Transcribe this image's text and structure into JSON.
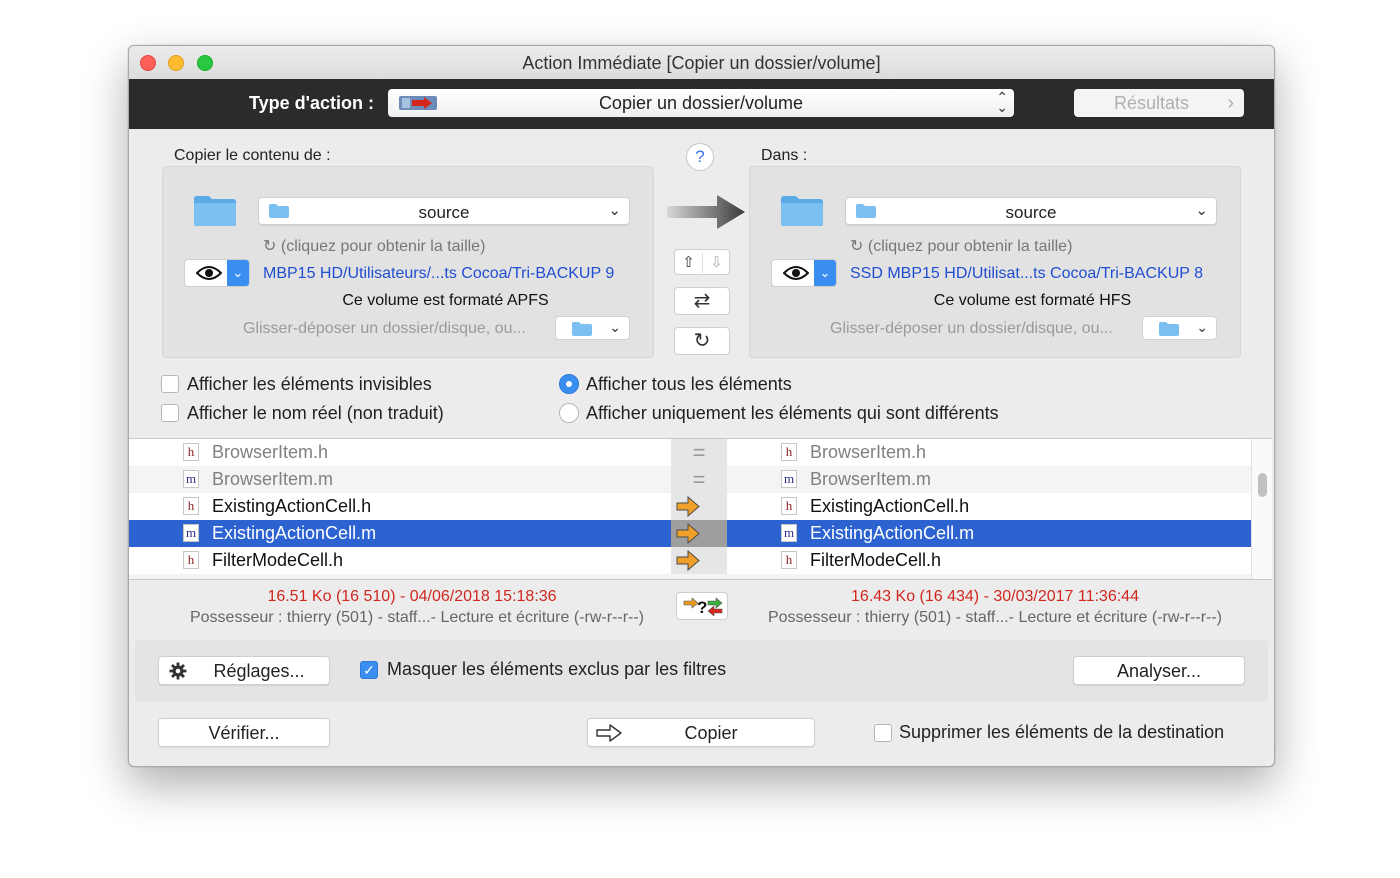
{
  "window": {
    "title": "Action Immédiate [Copier un dossier/volume]"
  },
  "header": {
    "type_label": "Type d'action :",
    "action_value": "Copier un dossier/volume",
    "results_label": "Résultats"
  },
  "source": {
    "heading": "Copier le contenu de :",
    "folder_name": "source",
    "size_hint": "(cliquez pour obtenir la taille)",
    "path": "MBP15 HD/Utilisateurs/...ts Cocoa/Tri-BACKUP 9",
    "format": "Ce volume est formaté APFS",
    "drop_hint": "Glisser-déposer un dossier/disque, ou..."
  },
  "destination": {
    "heading": "Dans :",
    "folder_name": "source",
    "size_hint": "(cliquez pour obtenir la taille)",
    "path": "SSD MBP15 HD/Utilisat...ts Cocoa/Tri-BACKUP 8",
    "format": "Ce volume est formaté HFS",
    "drop_hint": "Glisser-déposer un dossier/disque, ou..."
  },
  "help": {
    "label": "?"
  },
  "options": {
    "show_invisible": "Afficher les éléments invisibles",
    "show_real_name": "Afficher le nom réel (non traduit)",
    "show_all": "Afficher tous les éléments",
    "show_different": "Afficher uniquement les éléments qui sont différents"
  },
  "files": [
    {
      "left_type": "h",
      "left": "BrowserItem.h",
      "status": "equal",
      "status_symbol": "=",
      "right_type": "h",
      "right": "BrowserItem.h"
    },
    {
      "left_type": "m",
      "left": "BrowserItem.m",
      "status": "equal",
      "status_symbol": "=",
      "right_type": "m",
      "right": "BrowserItem.m"
    },
    {
      "left_type": "h",
      "left": "ExistingActionCell.h",
      "status": "copy",
      "status_symbol": "",
      "right_type": "h",
      "right": "ExistingActionCell.h"
    },
    {
      "left_type": "m",
      "left": "ExistingActionCell.m",
      "status": "copy",
      "status_symbol": "",
      "right_type": "m",
      "right": "ExistingActionCell.m",
      "selected": true
    },
    {
      "left_type": "h",
      "left": "FilterModeCell.h",
      "status": "copy",
      "status_symbol": "",
      "right_type": "h",
      "right": "FilterModeCell.h"
    }
  ],
  "left_info": {
    "size_date": "16.51 Ko (16 510) - 04/06/2018 15:18:36",
    "owner": "Possesseur : thierry (501) - staff...- Lecture et écriture (-rw-r--r--)"
  },
  "right_info": {
    "size_date": "16.43 Ko (16 434) - 30/03/2017 11:36:44",
    "owner": "Possesseur : thierry (501) - staff...- Lecture et écriture (-rw-r--r--)"
  },
  "footer": {
    "settings_label": "Réglages...",
    "hide_excluded_label": "Masquer les éléments exclus par les filtres",
    "analyze_label": "Analyser...",
    "verify_label": "Vérifier...",
    "copy_label": "Copier",
    "delete_dest_label": "Supprimer les éléments de la destination"
  },
  "colors": {
    "accent": "#3a8ef0",
    "selection": "#2d63d1",
    "path_link": "#1f4ed2",
    "info_red": "#d0281f",
    "dark_bar": "#2b2b2b"
  }
}
